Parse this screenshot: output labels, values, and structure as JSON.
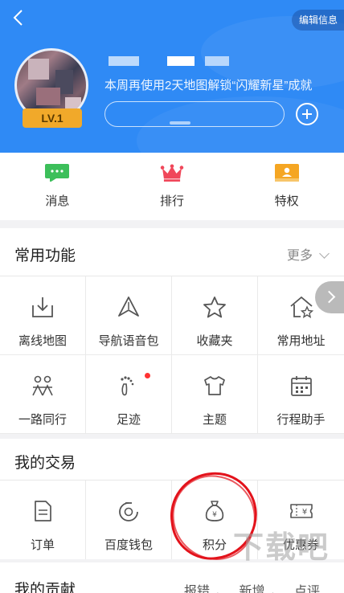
{
  "header": {
    "back_icon": "chevron-left-icon",
    "edit_label": "编辑信息",
    "level": "LV.1",
    "tip": "本周再使用2天地图解锁“闪耀新星”成就",
    "add_icon": "plus-circle-icon"
  },
  "quick_tabs": [
    {
      "label": "消息",
      "icon": "message-icon",
      "color": "#3cbf5a"
    },
    {
      "label": "排行",
      "icon": "crown-icon",
      "color": "#f0475a"
    },
    {
      "label": "特权",
      "icon": "card-icon",
      "color": "#f5a623"
    }
  ],
  "common": {
    "title": "常用功能",
    "more": "更多",
    "items": [
      {
        "label": "离线地图",
        "icon": "download-map-icon"
      },
      {
        "label": "导航语音包",
        "icon": "navigation-voice-icon"
      },
      {
        "label": "收藏夹",
        "icon": "star-icon"
      },
      {
        "label": "常用地址",
        "icon": "home-star-icon"
      },
      {
        "label": "一路同行",
        "icon": "people-icon"
      },
      {
        "label": "足迹",
        "icon": "footprint-icon",
        "dot": true
      },
      {
        "label": "主题",
        "icon": "shirt-icon"
      },
      {
        "label": "行程助手",
        "icon": "calendar-icon"
      }
    ]
  },
  "trade": {
    "title": "我的交易",
    "items": [
      {
        "label": "订单",
        "icon": "document-icon"
      },
      {
        "label": "百度钱包",
        "icon": "wallet-icon"
      },
      {
        "label": "积分",
        "icon": "money-bag-icon"
      },
      {
        "label": "优惠券",
        "icon": "coupon-icon"
      }
    ]
  },
  "contribution": {
    "title": "我的贡献",
    "tabs": [
      "报错",
      "新增",
      "点评"
    ]
  },
  "watermark": "下载吧"
}
